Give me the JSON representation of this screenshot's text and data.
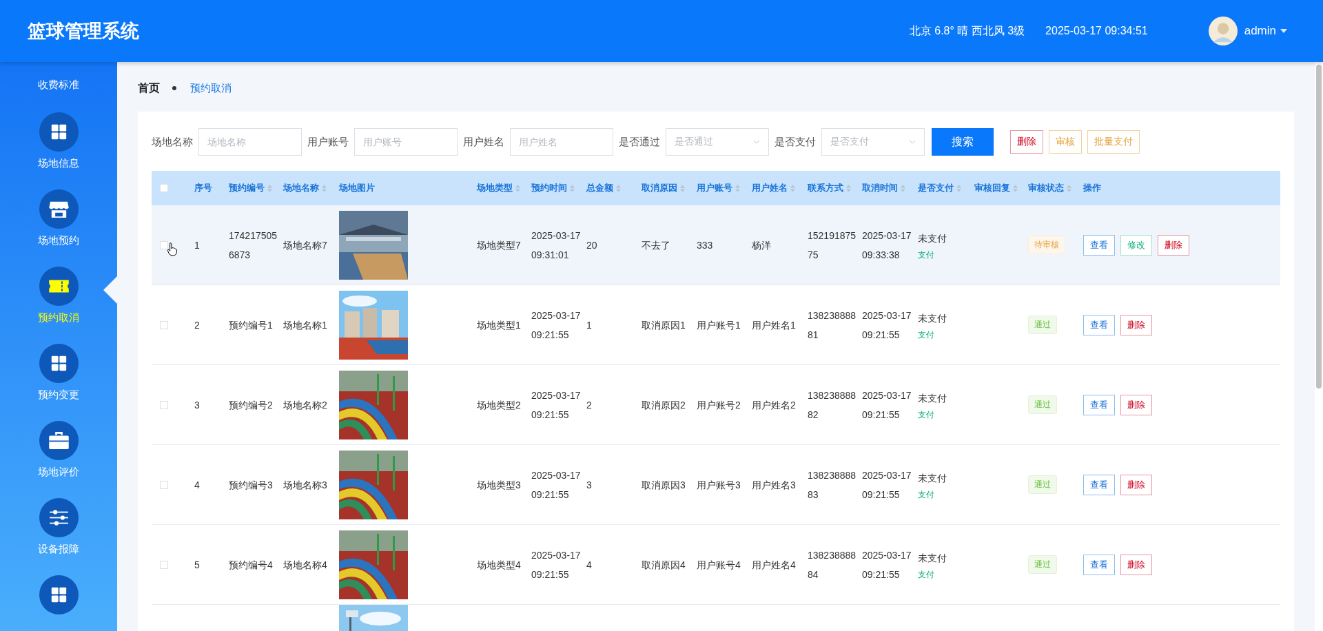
{
  "header": {
    "title": "篮球管理系统",
    "weather": "北京 6.8° 晴 西北风 3级",
    "datetime": "2025-03-17 09:34:51",
    "user": "admin"
  },
  "sidebar": {
    "items": [
      {
        "label": "收费标准",
        "kind": "none",
        "selected": false
      },
      {
        "label": "场地信息",
        "kind": "grid",
        "selected": false
      },
      {
        "label": "场地预约",
        "kind": "shop",
        "selected": false
      },
      {
        "label": "预约取消",
        "kind": "ticket",
        "selected": true
      },
      {
        "label": "预约变更",
        "kind": "grid",
        "selected": false
      },
      {
        "label": "场地评价",
        "kind": "briefcase",
        "selected": false
      },
      {
        "label": "设备报障",
        "kind": "sliders",
        "selected": false
      },
      {
        "kind": "grid",
        "selected": false
      }
    ]
  },
  "breadcrumb": [
    "首页",
    "预约取消"
  ],
  "filters": [
    {
      "label": "场地名称",
      "placeholder": "场地名称",
      "kind": "input"
    },
    {
      "label": "用户账号",
      "placeholder": "用户账号",
      "kind": "input"
    },
    {
      "label": "用户姓名",
      "placeholder": "用户姓名",
      "kind": "input"
    },
    {
      "label": "是否通过",
      "placeholder": "是否通过",
      "kind": "select"
    },
    {
      "label": "是否支付",
      "placeholder": "是否支付",
      "kind": "select"
    }
  ],
  "search_button": "搜索",
  "toolbar_buttons": [
    {
      "label": "删除",
      "kind": "danger"
    },
    {
      "label": "审核",
      "kind": "warning"
    },
    {
      "label": "批量支付",
      "kind": "warning"
    }
  ],
  "table": {
    "all_checked": false,
    "columns": [
      {
        "label": "序号",
        "sortable": false
      },
      {
        "label": "预约编号",
        "sortable": true
      },
      {
        "label": "场地名称",
        "sortable": true
      },
      {
        "label": "场地图片",
        "sortable": false
      },
      {
        "label": "场地类型",
        "sortable": true
      },
      {
        "label": "预约时间",
        "sortable": true
      },
      {
        "label": "总金额",
        "sortable": true
      },
      {
        "label": "取消原因",
        "sortable": true
      },
      {
        "label": "用户账号",
        "sortable": true
      },
      {
        "label": "用户姓名",
        "sortable": true
      },
      {
        "label": "联系方式",
        "sortable": true
      },
      {
        "label": "取消时间",
        "sortable": true
      },
      {
        "label": "是否支付",
        "sortable": true
      },
      {
        "label": "审核回复",
        "sortable": true
      },
      {
        "label": "审核状态",
        "sortable": true
      },
      {
        "label": "操作",
        "sortable": false
      }
    ],
    "rows": [
      {
        "highlighted": true,
        "checked": false,
        "cells": [
          "1",
          "1742175056873",
          "场地名称7",
          "",
          "场地类型7",
          "2025-03-17 09:31:01",
          "20",
          "不去了",
          "333",
          "杨洋",
          "15219187575",
          "2025-03-17 09:33:38",
          "未支付",
          ""
        ],
        "pay_link": "支付",
        "review": {
          "label": "待审核",
          "kind": "pending"
        },
        "actions": [
          {
            "label": "查看",
            "kind": "view"
          },
          {
            "label": "修改",
            "kind": "edit"
          },
          {
            "label": "删除",
            "kind": "delete"
          }
        ]
      },
      {
        "highlighted": false,
        "checked": false,
        "cells": [
          "2",
          "预约编号1",
          "场地名称1",
          "",
          "场地类型1",
          "2025-03-17 09:21:55",
          "1",
          "取消原因1",
          "用户账号1",
          "用户姓名1",
          "13823888881",
          "2025-03-17 09:21:55",
          "未支付",
          ""
        ],
        "pay_link": "支付",
        "review": {
          "label": "通过",
          "kind": "passed"
        },
        "actions": [
          {
            "label": "查看",
            "kind": "view"
          },
          {
            "label": "删除",
            "kind": "delete"
          }
        ]
      },
      {
        "highlighted": false,
        "checked": false,
        "cells": [
          "3",
          "预约编号2",
          "场地名称2",
          "",
          "场地类型2",
          "2025-03-17 09:21:55",
          "2",
          "取消原因2",
          "用户账号2",
          "用户姓名2",
          "13823888882",
          "2025-03-17 09:21:55",
          "未支付",
          ""
        ],
        "pay_link": "支付",
        "review": {
          "label": "通过",
          "kind": "passed"
        },
        "actions": [
          {
            "label": "查看",
            "kind": "view"
          },
          {
            "label": "删除",
            "kind": "delete"
          }
        ]
      },
      {
        "highlighted": false,
        "checked": false,
        "cells": [
          "4",
          "预约编号3",
          "场地名称3",
          "",
          "场地类型3",
          "2025-03-17 09:21:55",
          "3",
          "取消原因3",
          "用户账号3",
          "用户姓名3",
          "13823888883",
          "2025-03-17 09:21:55",
          "未支付",
          ""
        ],
        "pay_link": "支付",
        "review": {
          "label": "通过",
          "kind": "passed"
        },
        "actions": [
          {
            "label": "查看",
            "kind": "view"
          },
          {
            "label": "删除",
            "kind": "delete"
          }
        ]
      },
      {
        "highlighted": false,
        "checked": false,
        "cells": [
          "5",
          "预约编号4",
          "场地名称4",
          "",
          "场地类型4",
          "2025-03-17 09:21:55",
          "4",
          "取消原因4",
          "用户账号4",
          "用户姓名4",
          "13823888884",
          "2025-03-17 09:21:55",
          "未支付",
          ""
        ],
        "pay_link": "支付",
        "review": {
          "label": "通过",
          "kind": "passed"
        },
        "actions": [
          {
            "label": "查看",
            "kind": "view"
          },
          {
            "label": "删除",
            "kind": "delete"
          }
        ]
      }
    ]
  }
}
